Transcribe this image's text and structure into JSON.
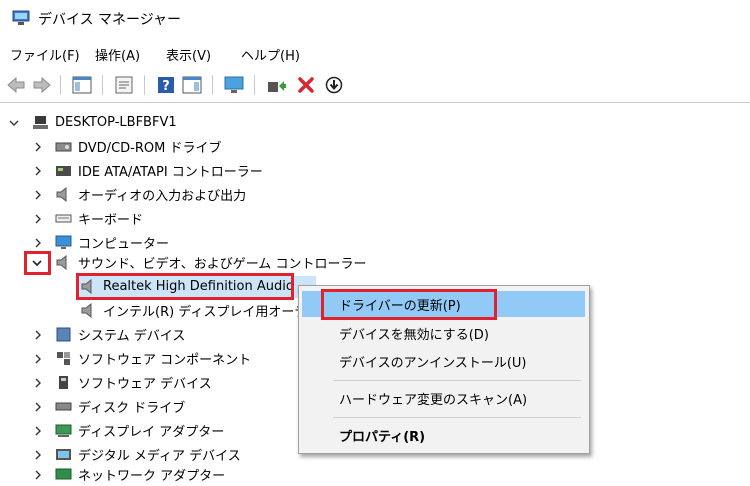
{
  "window": {
    "title": "デバイス マネージャー"
  },
  "menu": [
    "ファイル(F)",
    "操作(A)",
    "表示(V)",
    "ヘルプ(H)"
  ],
  "toolbar": {
    "buttons": [
      "back-icon",
      "forward-icon",
      "show-hide-tree-icon",
      "properties-icon",
      "help-icon",
      "action-pane-icon",
      "monitor-icon",
      "update-driver-icon",
      "uninstall-icon",
      "disable-icon"
    ]
  },
  "tree": {
    "root": "DESKTOP-LBFBFV1",
    "items": [
      "DVD/CD-ROM ドライブ",
      "IDE ATA/ATAPI コントローラー",
      "オーディオの入力および出力",
      "キーボード",
      "コンピューター",
      "サウンド、ビデオ、およびゲーム コントローラー",
      "Realtek High Definition Audio",
      "インテル(R) ディスプレイ用オーディオ",
      "システム デバイス",
      "ソフトウェア コンポーネント",
      "ソフトウェア デバイス",
      "ディスク ドライブ",
      "ディスプレイ アダプター",
      "デジタル メディア デバイス",
      "ネットワーク アダプター"
    ]
  },
  "context_menu": {
    "items": [
      "ドライバーの更新(P)",
      "デバイスを無効にする(D)",
      "デバイスのアンインストール(U)",
      "ハードウェア変更のスキャン(A)",
      "プロパティ(R)"
    ]
  },
  "colors": {
    "highlight_box": "#e0222f",
    "selection": "#cce4f7",
    "menu_hover": "#91c9f7"
  }
}
